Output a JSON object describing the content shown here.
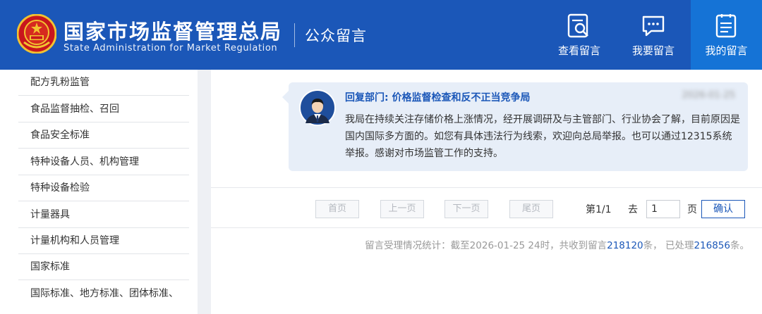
{
  "header": {
    "logo_cn": "国家市场监督管理总局",
    "logo_en": "State Administration for Market Regulation",
    "section_title": "公众留言",
    "nav": [
      {
        "label": "查看留言",
        "icon": "search-document-icon",
        "active": false
      },
      {
        "label": "我要留言",
        "icon": "chat-bubble-icon",
        "active": false
      },
      {
        "label": "我的留言",
        "icon": "list-document-icon",
        "active": true
      }
    ]
  },
  "sidebar": {
    "items": [
      {
        "label": "配方乳粉监管"
      },
      {
        "label": "食品监督抽检、召回"
      },
      {
        "label": "食品安全标准"
      },
      {
        "label": "特种设备人员、机构管理"
      },
      {
        "label": "特种设备检验"
      },
      {
        "label": "计量器具"
      },
      {
        "label": "计量机构和人员管理"
      },
      {
        "label": "国家标准"
      },
      {
        "label": "国际标准、地方标准、团体标准、"
      }
    ]
  },
  "reply": {
    "department": "回复部门: 价格监督检查和反不正当竞争局",
    "date": "2026-01-25",
    "body": "我局在持续关注存储价格上涨情况，经开展调研及与主管部门、行业协会了解，目前原因是国内国际多方面的。如您有具体违法行为线索，欢迎向总局举报。也可以通过12315系统举报。感谢对市场监管工作的支持。"
  },
  "pager": {
    "first": "首页",
    "prev": "上一页",
    "next": "下一页",
    "last": "尾页",
    "page_info": "第1/1",
    "goto_label": "去",
    "goto_value": "1",
    "page_unit": "页",
    "confirm": "确认"
  },
  "stats": {
    "prefix": "留言受理情况统计：截至2026-01-25 24时，共收到留言",
    "received": "218120",
    "middle": "条，  已处理",
    "processed": "216856",
    "suffix": "条。"
  },
  "colors": {
    "header_bg": "#1b57b8",
    "active_nav_bg": "#1573d6",
    "accent": "#1b57b8",
    "card_bg": "#e7eef8"
  }
}
